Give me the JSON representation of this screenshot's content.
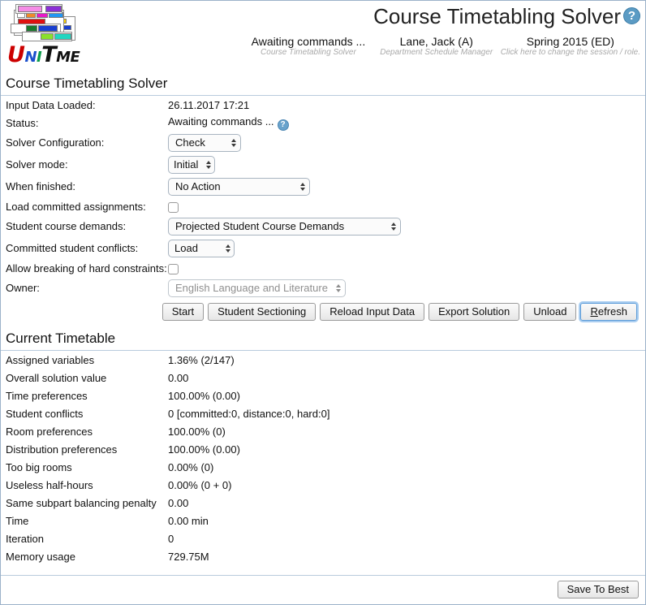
{
  "header": {
    "app_title": "Course Timetabling Solver",
    "help_icon": "question-mark-icon",
    "help_glyph": "?",
    "logo_word": {
      "u": "U",
      "n": "N",
      "i": "I",
      "t": "T",
      "ime": "ME"
    },
    "columns": [
      {
        "main": "Awaiting commands ...",
        "sub": "Course Timetabling Solver"
      },
      {
        "main": "Lane, Jack (A)",
        "sub": "Department Schedule Manager"
      },
      {
        "main": "Spring 2015 (ED)",
        "sub": "Click here to change the session / role."
      }
    ]
  },
  "solver": {
    "section_title": "Course Timetabling Solver",
    "labels": {
      "input_data_loaded": "Input Data Loaded:",
      "status": "Status:",
      "solver_configuration": "Solver Configuration:",
      "solver_mode": "Solver mode:",
      "when_finished": "When finished:",
      "load_committed": "Load committed assignments:",
      "student_course_demands": "Student course demands:",
      "committed_student_conflicts": "Committed student conflicts:",
      "allow_breaking": "Allow breaking of hard constraints:",
      "owner": "Owner:"
    },
    "values": {
      "input_data_loaded": "26.11.2017 17:21",
      "status": "Awaiting commands ...",
      "solver_configuration": "Check",
      "solver_mode": "Initial",
      "when_finished": "No Action",
      "student_course_demands": "Projected Student Course Demands",
      "committed_student_conflicts": "Load",
      "owner": "English Language and Literature"
    },
    "checkboxes": {
      "load_committed_checked": false,
      "allow_breaking_checked": false
    },
    "buttons": [
      {
        "label": "Start",
        "focused": false,
        "accesskey": ""
      },
      {
        "label": "Student Sectioning",
        "focused": false,
        "accesskey": ""
      },
      {
        "label": "Reload Input Data",
        "focused": false,
        "accesskey": ""
      },
      {
        "label": "Export Solution",
        "focused": false,
        "accesskey": ""
      },
      {
        "label": "Unload",
        "focused": false,
        "accesskey": ""
      },
      {
        "label": "Refresh",
        "focused": true,
        "accesskey": "R"
      }
    ]
  },
  "timetable": {
    "section_title": "Current Timetable",
    "rows": [
      {
        "label": "Assigned variables",
        "value": "1.36% (2/147)"
      },
      {
        "label": "Overall solution value",
        "value": "0.00"
      },
      {
        "label": "Time preferences",
        "value": "100.00% (0.00)"
      },
      {
        "label": "Student conflicts",
        "value": "0 [committed:0, distance:0, hard:0]"
      },
      {
        "label": "Room preferences",
        "value": "100.00% (0)"
      },
      {
        "label": "Distribution preferences",
        "value": "100.00% (0.00)"
      },
      {
        "label": "Too big rooms",
        "value": "0.00% (0)"
      },
      {
        "label": "Useless half-hours",
        "value": "0.00% (0 + 0)"
      },
      {
        "label": "Same subpart balancing penalty",
        "value": "0.00"
      },
      {
        "label": "Time",
        "value": "0.00 min"
      },
      {
        "label": "Iteration",
        "value": "0"
      },
      {
        "label": "Memory usage",
        "value": "729.75M"
      }
    ]
  },
  "footer": {
    "save_to_best": "Save To Best"
  },
  "colors": {
    "accent_blue": "#5b9bc4",
    "rule_blue": "#b9cbdd",
    "muted_grey": "#a9a9a9",
    "focus_ring": "#a9cdf0"
  }
}
